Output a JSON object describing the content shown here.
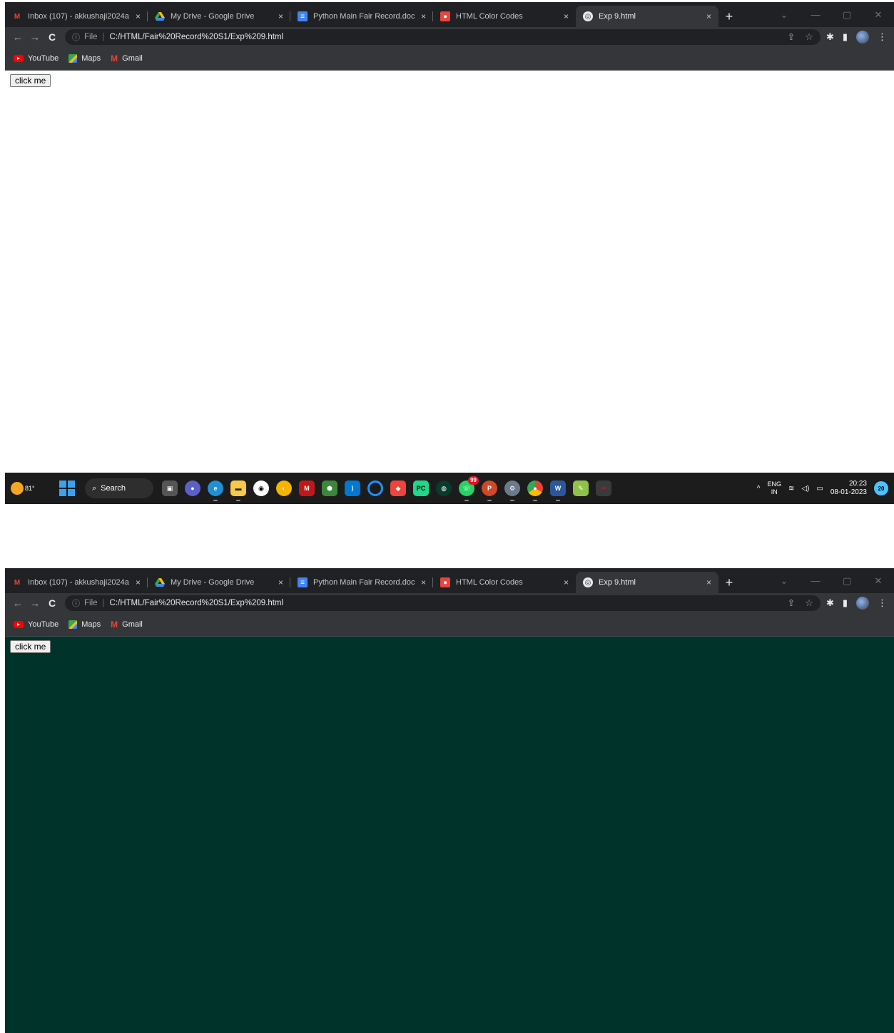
{
  "browser": {
    "tabs": [
      {
        "title": "Inbox (107) - akkushaji2024a",
        "icon": "gmail-icon",
        "close": "×"
      },
      {
        "title": "My Drive - Google Drive",
        "icon": "drive-icon",
        "close": "×"
      },
      {
        "title": "Python Main Fair Record.doc",
        "icon": "docs-icon",
        "close": "×"
      },
      {
        "title": "HTML Color Codes",
        "icon": "htmlcolor-icon",
        "close": "×"
      },
      {
        "title": "Exp 9.html",
        "icon": "globe-icon",
        "close": "×"
      }
    ],
    "new_tab": "+",
    "address": {
      "info": "ⓘ",
      "scheme": "File",
      "url": "C:/HTML/Fair%20Record%20S1/Exp%209.html"
    },
    "bookmarks": [
      {
        "label": "YouTube",
        "icon": "youtube-icon"
      },
      {
        "label": "Maps",
        "icon": "maps-icon"
      },
      {
        "label": "Gmail",
        "icon": "gmail-icon"
      }
    ]
  },
  "page": {
    "button_label": "click me"
  },
  "states": [
    {
      "background": "#ffffff",
      "taskbar_visible": true
    },
    {
      "background": "#003329",
      "taskbar_visible": false
    }
  ],
  "taskbar": {
    "temperature": "81°",
    "search_label": "Search",
    "whatsapp_badge": "99",
    "lang_top": "ENG",
    "lang_bottom": "IN",
    "time": "20:23",
    "date": "08-01-2023",
    "notifications": "20"
  }
}
